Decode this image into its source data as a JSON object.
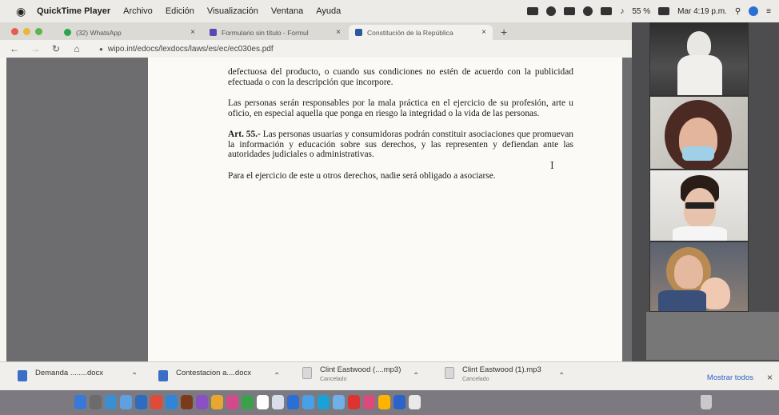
{
  "menubar": {
    "app_name": "QuickTime Player",
    "items": [
      "Archivo",
      "Edición",
      "Visualización",
      "Ventana",
      "Ayuda"
    ],
    "battery": "55 %",
    "clock": "Mar 4:19 p.m."
  },
  "browser": {
    "tabs": [
      {
        "label": "(32) WhatsApp",
        "color": "#2aa54a"
      },
      {
        "label": "Formulario sin título - Formul",
        "color": "#5b46b8"
      },
      {
        "label": "Constitución de la República",
        "color": "#2c5aa0"
      }
    ],
    "new_tab": "+",
    "url": "wipo.int/edocs/lexdocs/laws/es/ec/ec030es.pdf"
  },
  "document": {
    "para1": "defectuosa del producto, o cuando sus condiciones no estén de acuerdo con la publicidad efectuada o con la descripción que incorpore.",
    "para2": "Las personas serán responsables por la mala práctica en el ejercicio de su profesión, arte u oficio, en especial aquella que ponga en riesgo la integridad o la vida de las personas.",
    "art_label": "Art. 55.-",
    "art_text": " Las personas usuarias y consumidoras podrán constituir asociaciones que promuevan la información y educación sobre sus derechos, y las representen y defiendan ante las autoridades judiciales o administrativas.",
    "para4": "Para el ejercicio de este u otros derechos, nadie será obligado a asociarse."
  },
  "downloads": {
    "items": [
      {
        "name": "Demanda ........docx",
        "sub": ""
      },
      {
        "name": "Contestacion a....docx",
        "sub": ""
      },
      {
        "name": "Clint Eastwood (....mp3)",
        "sub": "Cancelado"
      },
      {
        "name": "Clint Eastwood (1).mp3",
        "sub": "Cancelado"
      }
    ],
    "show_all": "Mostrar todos",
    "close": "×"
  },
  "dock_colors": [
    "#3a78d8",
    "#6b6b6b",
    "#3b8fd0",
    "#5fa0e0",
    "#2f6cc0",
    "#e04a3a",
    "#2f86d8",
    "#7a3b1c",
    "#8a4fc2",
    "#e8a830",
    "#d34a8a",
    "#3aa14a",
    "#ffffff",
    "#d8dee9",
    "#2a6ed6",
    "#49a0e8",
    "#18a2d8",
    "#6fb0e8",
    "#d33",
    "#d94b7a",
    "#ffb400",
    "#2b63c9",
    "#e9e9e9"
  ]
}
